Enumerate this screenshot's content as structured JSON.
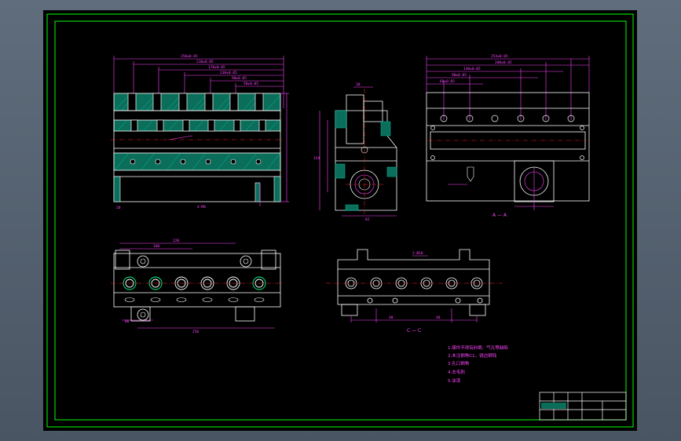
{
  "drawing": {
    "colors": {
      "background": "#000000",
      "border": "#00ff00",
      "outline": "#ffffff",
      "section": "#00c0a0",
      "dimension": "#ff44ff",
      "centerline": "#ff2020"
    },
    "section_label_aa": "A — A",
    "section_label_cc": "C — C",
    "notes": [
      "1.铸件不得有砂眼、气孔等缺陷",
      "2.未注倒角C1，锐边倒钝",
      "3.孔口倒角",
      "4.去毛刺",
      "5.涂漆"
    ]
  }
}
